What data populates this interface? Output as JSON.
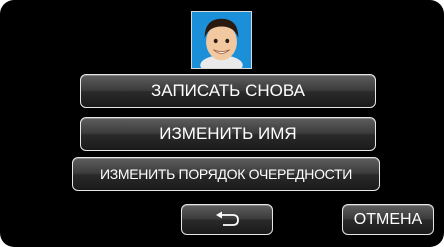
{
  "menu": {
    "record_again_label": "ЗАПИСАТЬ СНОВА",
    "change_name_label": "ИЗМЕНИТЬ ИМЯ",
    "change_order_label": "ИЗМЕНИТЬ ПОРЯДОК ОЧЕРЕДНОСТИ"
  },
  "footer": {
    "back_icon": "return-arrow-icon",
    "cancel_label": "ОТМЕНА"
  },
  "colors": {
    "screen_background": "#000000",
    "button_border": "#e6e6e6",
    "button_text": "#ffffff",
    "avatar_background": "#1c8fd9"
  }
}
